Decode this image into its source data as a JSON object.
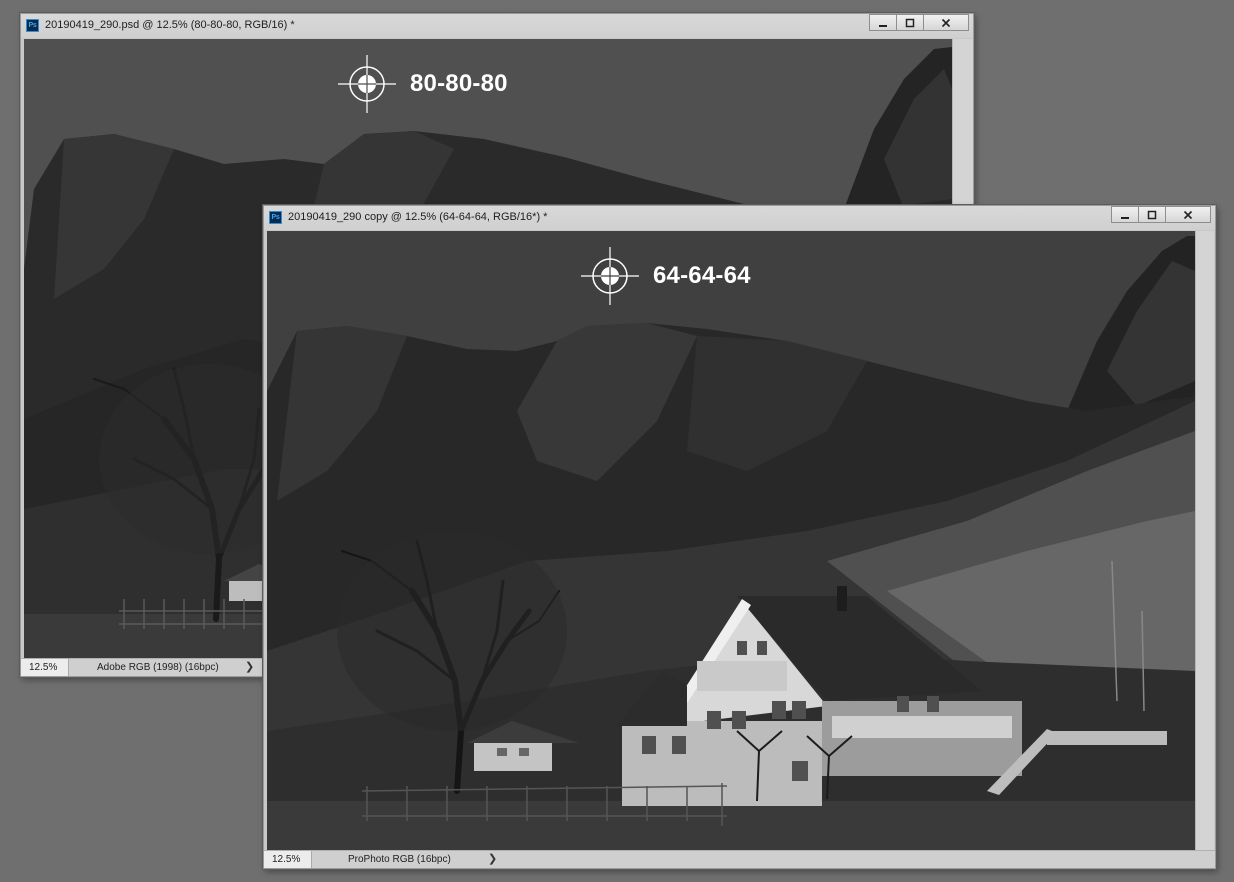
{
  "windows": [
    {
      "id": "back",
      "title": "20190419_290.psd @ 12.5% (80-80-80, RGB/16) *",
      "zoom": "12.5%",
      "profile": "Adobe RGB (1998) (16bpc)",
      "sample_label": "80-80-80",
      "sky_color": "#505050",
      "icon": "ps-icon"
    },
    {
      "id": "front",
      "title": "20190419_290 copy @ 12.5% (64-64-64, RGB/16*) *",
      "zoom": "12.5%",
      "profile": "ProPhoto RGB (16bpc)",
      "sample_label": "64-64-64",
      "sky_color": "#404040",
      "icon": "ps-icon"
    }
  ],
  "app_badge": "Ps",
  "icons": {
    "minimize": "minimize-icon",
    "maximize": "maximize-icon",
    "close": "close-icon",
    "sampler": "color-sampler-crosshair-icon",
    "status_arrow": "chevron-right-icon"
  },
  "status_arrow": "❯"
}
